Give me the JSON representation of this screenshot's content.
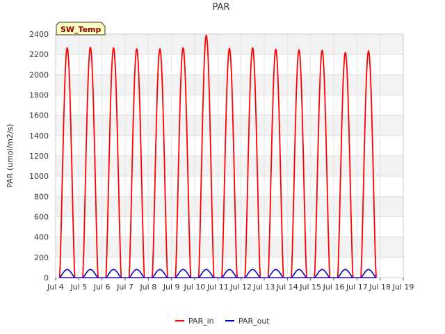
{
  "chart_data": {
    "type": "line",
    "title": "PAR",
    "badge": "SW_Temp",
    "xlabel": "",
    "ylabel": "PAR (umol/m2/s)",
    "ylim": [
      0,
      2400
    ],
    "yticks": [
      0,
      200,
      400,
      600,
      800,
      1000,
      1200,
      1400,
      1600,
      1800,
      2000,
      2200,
      2400
    ],
    "xlim": [
      4,
      19
    ],
    "xticks": [
      {
        "day": 4,
        "label": "Jul 4"
      },
      {
        "day": 5,
        "label": "Jul 5"
      },
      {
        "day": 6,
        "label": "Jul 6"
      },
      {
        "day": 7,
        "label": "Jul 7"
      },
      {
        "day": 8,
        "label": "Jul 8"
      },
      {
        "day": 9,
        "label": "Jul 9"
      },
      {
        "day": 10,
        "label": "Jul 10"
      },
      {
        "day": 11,
        "label": "Jul 11"
      },
      {
        "day": 12,
        "label": "Jul 12"
      },
      {
        "day": 13,
        "label": "Jul 13"
      },
      {
        "day": 14,
        "label": "Jul 14"
      },
      {
        "day": 15,
        "label": "Jul 15"
      },
      {
        "day": 16,
        "label": "Jul 16"
      },
      {
        "day": 17,
        "label": "Jul 17"
      },
      {
        "day": 18,
        "label": "Jul 18"
      },
      {
        "day": 19,
        "label": "Jul 19"
      }
    ],
    "grid": true,
    "legend_position": "bottom-center",
    "series": [
      {
        "name": "PAR_in",
        "color": "#ff0000",
        "peaks": [
          {
            "day": 4.5,
            "peak": 2265
          },
          {
            "day": 5.5,
            "peak": 2270
          },
          {
            "day": 6.5,
            "peak": 2265
          },
          {
            "day": 7.5,
            "peak": 2255
          },
          {
            "day": 8.5,
            "peak": 2255
          },
          {
            "day": 9.5,
            "peak": 2265
          },
          {
            "day": 10.5,
            "peak": 2390
          },
          {
            "day": 11.5,
            "peak": 2260
          },
          {
            "day": 12.5,
            "peak": 2265
          },
          {
            "day": 13.5,
            "peak": 2250
          },
          {
            "day": 14.5,
            "peak": 2245
          },
          {
            "day": 15.5,
            "peak": 2240
          },
          {
            "day": 16.5,
            "peak": 2220
          },
          {
            "day": 17.5,
            "peak": 2235
          }
        ]
      },
      {
        "name": "PAR_out",
        "color": "#0000cc",
        "peaks": [
          {
            "day": 4.5,
            "peak": 80
          },
          {
            "day": 5.5,
            "peak": 80
          },
          {
            "day": 6.5,
            "peak": 80
          },
          {
            "day": 7.5,
            "peak": 80
          },
          {
            "day": 8.5,
            "peak": 80
          },
          {
            "day": 9.5,
            "peak": 80
          },
          {
            "day": 10.5,
            "peak": 80
          },
          {
            "day": 11.5,
            "peak": 80
          },
          {
            "day": 12.5,
            "peak": 80
          },
          {
            "day": 13.5,
            "peak": 80
          },
          {
            "day": 14.5,
            "peak": 80
          },
          {
            "day": 15.5,
            "peak": 80
          },
          {
            "day": 16.5,
            "peak": 80
          },
          {
            "day": 17.5,
            "peak": 80
          }
        ]
      }
    ]
  }
}
